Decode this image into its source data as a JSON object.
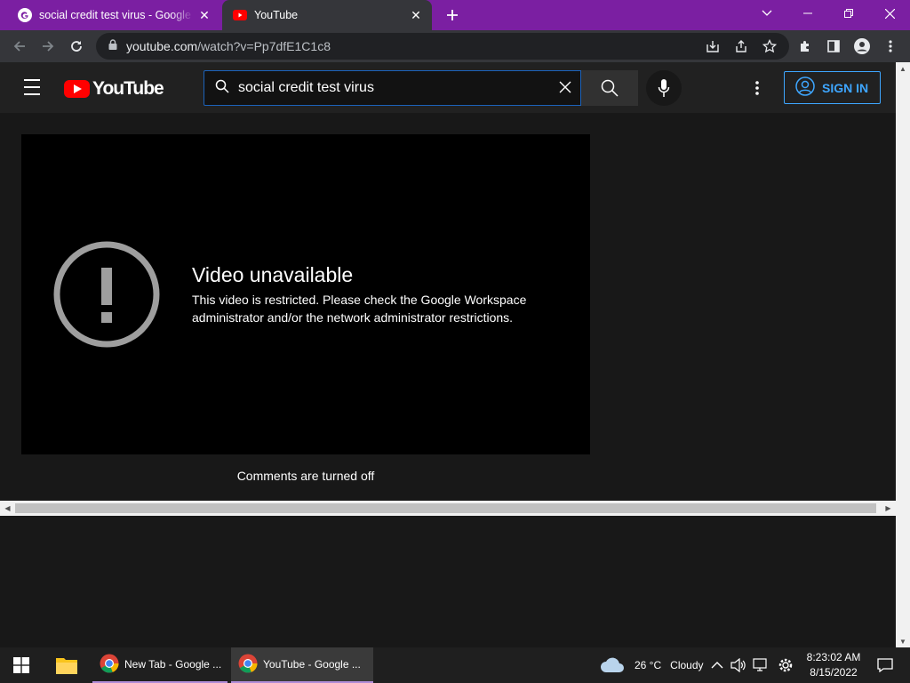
{
  "browser": {
    "tabs": [
      {
        "title": "social credit test virus - Google Search",
        "favicon": "google-icon",
        "active": false
      },
      {
        "title": "YouTube",
        "favicon": "youtube-icon",
        "active": true
      }
    ],
    "url_host": "youtube.com",
    "url_path": "/watch?v=Pp7dfE1C1c8",
    "window_controls": [
      "tab-search-icon",
      "minimize-icon",
      "restore-icon",
      "close-icon"
    ],
    "toolbar_icons": [
      "back-icon",
      "forward-icon",
      "reload-icon",
      "lock-icon",
      "install-icon",
      "share-icon",
      "bookmark-star-icon",
      "extensions-icon",
      "side-panel-icon",
      "profile-icon",
      "menu-icon"
    ]
  },
  "youtube": {
    "logo_text": "YouTube",
    "search_query": "social credit test virus",
    "sign_in_label": "SIGN IN",
    "player": {
      "error_title": "Video unavailable",
      "error_message": "This video is restricted. Please check the Google Workspace administrator and/or the network administrator restrictions."
    },
    "comments_status": "Comments are turned off"
  },
  "taskbar": {
    "apps": [
      {
        "label": "New Tab - Google ...",
        "icon": "chrome-icon"
      },
      {
        "label": "YouTube - Google ...",
        "icon": "chrome-icon"
      }
    ],
    "weather": {
      "temp": "26 °C",
      "condition": "Cloudy"
    },
    "time": "8:23:02 AM",
    "date": "8/15/2022"
  },
  "colors": {
    "tabstrip": "#7b1fa2",
    "youtube_red": "#ff0000",
    "signin_blue": "#3ea6ff",
    "search_focus": "#1c62b9"
  }
}
